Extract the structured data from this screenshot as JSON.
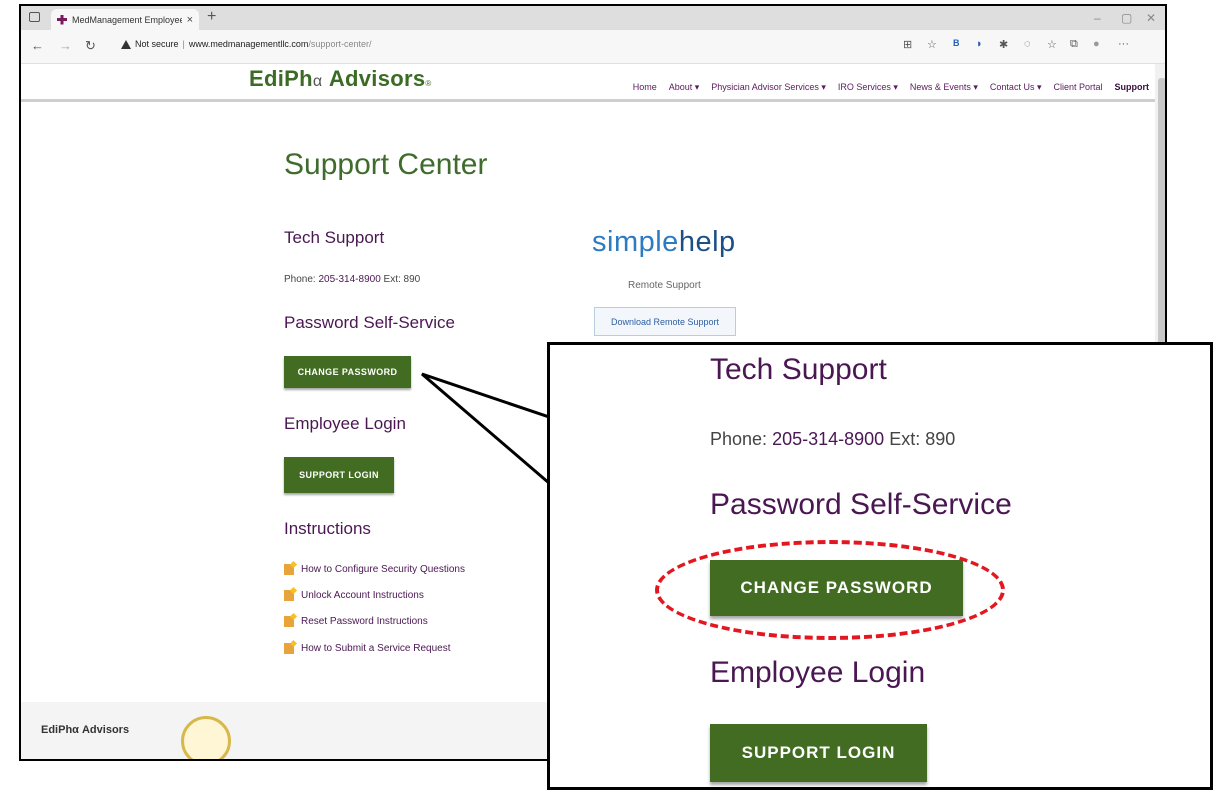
{
  "browser": {
    "tab_title": "MedManagement Employee Log",
    "tab_close": "×",
    "new_tab": "+",
    "security_label": "Not secure",
    "url_domain": "www.medmanagementllc.com",
    "url_path": "/support-center/",
    "icons": [
      "back-icon",
      "forward-icon",
      "refresh-icon",
      "warning-icon",
      "reader-icon",
      "favorite-icon",
      "bing-icon",
      "extension-icon",
      "extensions-icon",
      "split-icon",
      "favorites-icon",
      "collections-icon",
      "profile-icon",
      "more-icon"
    ]
  },
  "site": {
    "logo_text": "EdiPh",
    "logo_alpha": "α",
    "logo_suffix": " Advisors",
    "logo_mark": "®",
    "nav": [
      {
        "label": "Home"
      },
      {
        "label": "About ▾"
      },
      {
        "label": "Physician Advisor Services ▾"
      },
      {
        "label": "IRO Services ▾"
      },
      {
        "label": "News & Events ▾"
      },
      {
        "label": "Contact Us ▾"
      },
      {
        "label": "Client Portal"
      },
      {
        "label": "Support"
      }
    ],
    "active_nav": "Support"
  },
  "main": {
    "title": "Support Center",
    "tech_support": "Tech Support",
    "phone_label": "Phone:",
    "phone_number": "205-314-8900",
    "ext": "Ext: 890",
    "password_heading": "Password Self-Service",
    "change_password": "CHANGE PASSWORD",
    "employee_login": "Employee Login",
    "support_login": "SUPPORT LOGIN",
    "instructions_heading": "Instructions",
    "instructions": [
      "How to Configure Security Questions",
      "Unlock Account Instructions",
      "Reset Password Instructions",
      "How to Submit a Service Request"
    ]
  },
  "simplehelp": {
    "logo_a": "simple",
    "logo_b": "help",
    "subtitle": "Remote Support",
    "button": "Download Remote Support"
  },
  "footer": {
    "logo": "EdiPhα Advisors"
  },
  "colors": {
    "brand_green": "#426c22",
    "brand_purple": "#4a1752",
    "highlight_red": "#e3171f"
  }
}
